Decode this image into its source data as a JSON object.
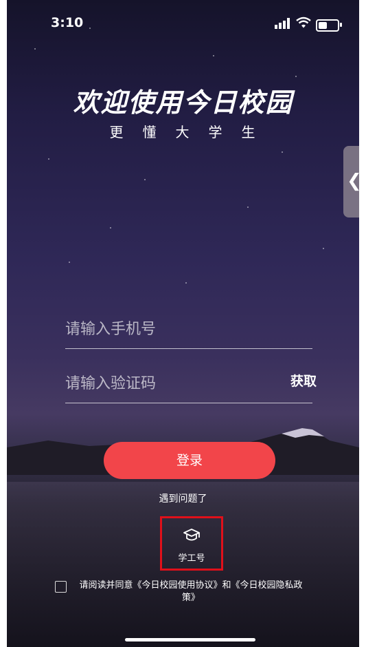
{
  "status_bar": {
    "time": "3:10"
  },
  "header": {
    "title": "欢迎使用今日校园",
    "subtitle": "更懂大学生"
  },
  "side_tab": {
    "label": "❮"
  },
  "form": {
    "phone_placeholder": "请输入手机号",
    "code_placeholder": "请输入验证码",
    "get_code_label": "获取",
    "login_label": "登录",
    "help_label": "遇到问题了"
  },
  "alt_login": {
    "icon": "graduation-cap-icon",
    "label": "学工号"
  },
  "agreement": {
    "text": "请阅读并同意《今日校园使用协议》和《今日校园隐私政策》"
  }
}
